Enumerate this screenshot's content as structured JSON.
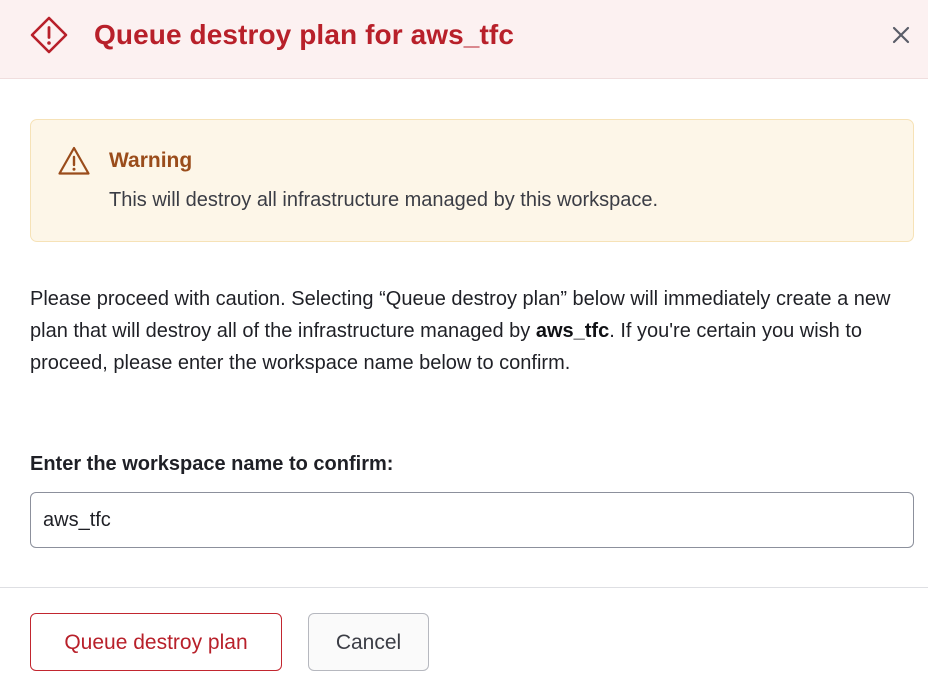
{
  "dialog": {
    "title": "Queue destroy plan for aws_tfc",
    "close_label": "×"
  },
  "warning": {
    "title": "Warning",
    "message": "This will destroy all infrastructure managed by this workspace."
  },
  "description": {
    "part1": "Please proceed with caution. Selecting “Queue destroy plan” below will immediately create a new plan that will destroy all of the infrastructure managed by ",
    "workspace": "aws_tfc",
    "part2": ". If you're certain you wish to proceed, please enter the workspace name below to confirm."
  },
  "confirm_field": {
    "label": "Enter the workspace name to confirm:",
    "value": "aws_tfc"
  },
  "actions": {
    "primary_label": "Queue destroy plan",
    "cancel_label": "Cancel"
  },
  "colors": {
    "critical": "#b8202a",
    "header_bg": "#fcf1f1",
    "warning_bg": "#fdf6e8",
    "warning_title": "#9a4c1b"
  },
  "icons": {
    "header": "alert-diamond-icon",
    "warning": "alert-triangle-icon",
    "close": "close-icon"
  }
}
